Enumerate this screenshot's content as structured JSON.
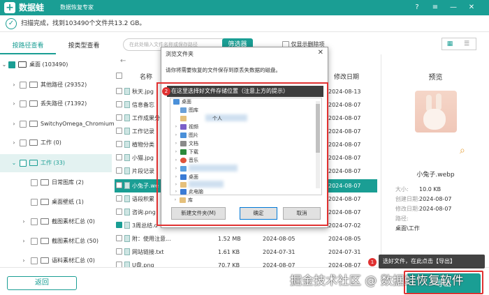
{
  "app": {
    "logo_glyph": "+",
    "name": "数据蛙",
    "subtitle": "数据恢复专家",
    "controls": [
      "?",
      "≡",
      "—",
      "✕"
    ]
  },
  "status": {
    "icon": "✓",
    "text": "扫描完成，找到103490个文件共13.2 GB。"
  },
  "tabs": {
    "by_path": "按路径查看",
    "by_type": "按类型查看"
  },
  "toolbar": {
    "search_placeholder": "在此处输入文件名称或保存路径",
    "filter_label": "筛选器",
    "show_deleted_label": "仅显示删除项"
  },
  "tree": [
    {
      "label": "桌面 (103490)",
      "expanded": true
    },
    {
      "label": "其他路径 (29352)"
    },
    {
      "label": "丢失路径 (71392)"
    },
    {
      "label": "SwitchyOmega_Chromium"
    },
    {
      "label": "工作 (0)"
    },
    {
      "label": "工作 (33)",
      "selected": true
    },
    {
      "label": "日常图库 (2)"
    },
    {
      "label": "桌面壁纸 (1)"
    },
    {
      "label": "截图素材汇总 (0)"
    },
    {
      "label": "截图素材汇总 (50)"
    },
    {
      "label": "语料素材汇总 (0)"
    }
  ],
  "list": {
    "name_header": "名称",
    "modified_header": "修改日期",
    "rows": [
      {
        "name": "秋天.jpg",
        "size": "",
        "date1": "",
        "date2": "2024-08-13"
      },
      {
        "name": "信息备忘",
        "size": "",
        "date1": "",
        "date2": "2024-08-07"
      },
      {
        "name": "工作成果分",
        "size": "",
        "date1": "",
        "date2": "2024-08-07"
      },
      {
        "name": "工作记录",
        "size": "",
        "date1": "",
        "date2": "2024-08-07"
      },
      {
        "name": "植物分类",
        "size": "",
        "date1": "",
        "date2": "2024-08-07"
      },
      {
        "name": "小猫.jpg",
        "size": "",
        "date1": "",
        "date2": "2024-08-07"
      },
      {
        "name": "片段记录",
        "size": "",
        "date1": "",
        "date2": "2024-08-07"
      },
      {
        "name": "小兔子.we",
        "size": "",
        "date1": "",
        "date2": "2024-08-07",
        "selected": true
      },
      {
        "name": "语段积累",
        "size": "",
        "date1": "",
        "date2": "2024-08-07"
      },
      {
        "name": "咨询.png",
        "size": "",
        "date1": "",
        "date2": "2024-08-07"
      },
      {
        "name": "3周总结.d",
        "size": "",
        "date1": "",
        "date2": "2024-07-02",
        "checked": true
      },
      {
        "name": "附：使用注意...",
        "size": "1.52 MB",
        "date1": "2024-08-05",
        "date2": "2024-08-05"
      },
      {
        "name": "网站链接.txt",
        "size": "1.61 KB",
        "date1": "2024-07-31",
        "date2": "2024-07-31"
      },
      {
        "name": "U盘.png",
        "size": "70.7 KB",
        "date1": "2024-08-07",
        "date2": "2024-08-07"
      }
    ]
  },
  "preview": {
    "title": "预览",
    "filename": "小兔子.webp",
    "fields": [
      {
        "key": "大小:",
        "value": "10.0 KB"
      },
      {
        "key": "创建日期:",
        "value": "2024-08-07"
      },
      {
        "key": "修改日期:",
        "value": "2024-08-07"
      },
      {
        "key": "路径:",
        "value": ""
      }
    ],
    "path_value": "桌面\\工作"
  },
  "dialog": {
    "title": "浏览文件夹",
    "close": "✕",
    "description": "请你将需要恢复的文件保存到原丢失数据的磁盘。",
    "banner_num": "2",
    "banner": "在这里选择好文件存储位置（注意上方的提示）",
    "tree": [
      {
        "label": "桌面",
        "indent": 0,
        "chev": "",
        "color": "#4a90d9"
      },
      {
        "label": "图库",
        "indent": 1,
        "chev": "›",
        "color": "#6aa0d8"
      },
      {
        "label": "个人",
        "indent": 1,
        "chev": "",
        "color": "#e5c07b"
      },
      {
        "label": "视频",
        "indent": 1,
        "chev": "›",
        "color": "#7b5fc9"
      },
      {
        "label": "图片",
        "indent": 1,
        "chev": "›",
        "color": "#4a90d9"
      },
      {
        "label": "文档",
        "indent": 1,
        "chev": "›",
        "color": "#8a8a8a"
      },
      {
        "label": "下载",
        "indent": 1,
        "chev": "›",
        "color": "#2a8a3a"
      },
      {
        "label": "音乐",
        "indent": 1,
        "chev": "›",
        "color": "#e0533a"
      },
      {
        "label": "",
        "indent": 1,
        "chev": "›",
        "color": "#5aa0e0"
      },
      {
        "label": "桌面",
        "indent": 1,
        "chev": "›",
        "color": "#3a7bd5"
      },
      {
        "label": "",
        "indent": 1,
        "chev": "›",
        "color": "#e5c07b"
      },
      {
        "label": "此电脑",
        "indent": 1,
        "chev": "›",
        "color": "#3a7bd5"
      },
      {
        "label": "库",
        "indent": 1,
        "chev": "›",
        "color": "#e5c07b"
      }
    ],
    "new_folder": "新建文件夹(M)",
    "ok": "确定",
    "cancel": "取消"
  },
  "hint": {
    "num": "1",
    "text": "选好文件，在此点击【导出】"
  },
  "bottom": {
    "back_label": "返回",
    "export_label": "导出"
  },
  "watermark": "掘金技术社区 @ 数据蛙恢复软件"
}
